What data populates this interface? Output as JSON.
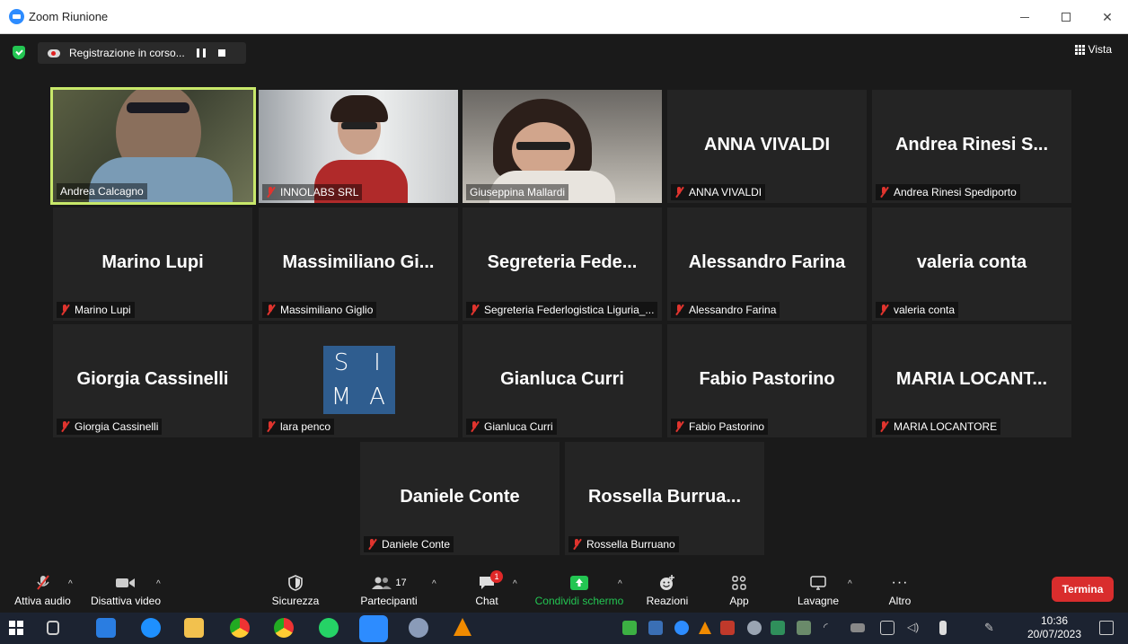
{
  "window": {
    "title": "Zoom Riunione"
  },
  "recording": {
    "label": "Registrazione in corso..."
  },
  "view": {
    "label": "Vista"
  },
  "tiles": [
    {
      "name": "Andrea Calcagno",
      "label": "Andrea Calcagno",
      "muted": false,
      "video": "v1"
    },
    {
      "name": "INNOLABS SRL",
      "label": "INNOLABS SRL",
      "muted": true,
      "video": "v2"
    },
    {
      "name": "Giuseppina Mallardi",
      "label": "Giuseppina Mallardi",
      "muted": false,
      "video": "v3"
    },
    {
      "name": "ANNA VIVALDI",
      "label": "ANNA VIVALDI",
      "muted": true
    },
    {
      "name": "Andrea Rinesi S...",
      "label": "Andrea Rinesi Spediporto",
      "muted": true
    },
    {
      "name": "Marino Lupi",
      "label": "Marino Lupi",
      "muted": true
    },
    {
      "name": "Massimiliano Gi...",
      "label": "Massimiliano Giglio",
      "muted": true
    },
    {
      "name": "Segreteria Fede...",
      "label": "Segreteria Federlogistica Liguria_...",
      "muted": true
    },
    {
      "name": "Alessandro Farina",
      "label": "Alessandro Farina",
      "muted": true
    },
    {
      "name": "valeria conta",
      "label": "valeria conta",
      "muted": true
    },
    {
      "name": "Giorgia Cassinelli",
      "label": "Giorgia Cassinelli",
      "muted": true
    },
    {
      "name": "lara penco",
      "label": "lara penco",
      "muted": true,
      "logo": [
        "S",
        "I",
        "M",
        "A"
      ]
    },
    {
      "name": "Gianluca Curri",
      "label": "Gianluca Curri",
      "muted": true
    },
    {
      "name": "Fabio Pastorino",
      "label": "Fabio Pastorino",
      "muted": true
    },
    {
      "name": "MARIA LOCANT...",
      "label": "MARIA LOCANTORE",
      "muted": true
    },
    {
      "name": "Daniele Conte",
      "label": "Daniele Conte",
      "muted": true
    },
    {
      "name": "Rossella Burrua...",
      "label": "Rossella Burruano",
      "muted": true
    }
  ],
  "toolbar": {
    "audio": "Attiva audio",
    "video": "Disattiva video",
    "security": "Sicurezza",
    "participants": "Partecipanti",
    "participants_count": "17",
    "chat": "Chat",
    "chat_badge": "1",
    "share": "Condividi schermo",
    "reactions": "Reazioni",
    "apps": "App",
    "whiteboards": "Lavagne",
    "more": "Altro",
    "end": "Termina"
  },
  "taskbar": {
    "time": "10:36",
    "date": "20/07/2023"
  },
  "colors": {
    "active_speaker": "#c8e86a",
    "share_green": "#23c552",
    "end_red": "#d92d2d",
    "muted_red": "#e0342e"
  }
}
